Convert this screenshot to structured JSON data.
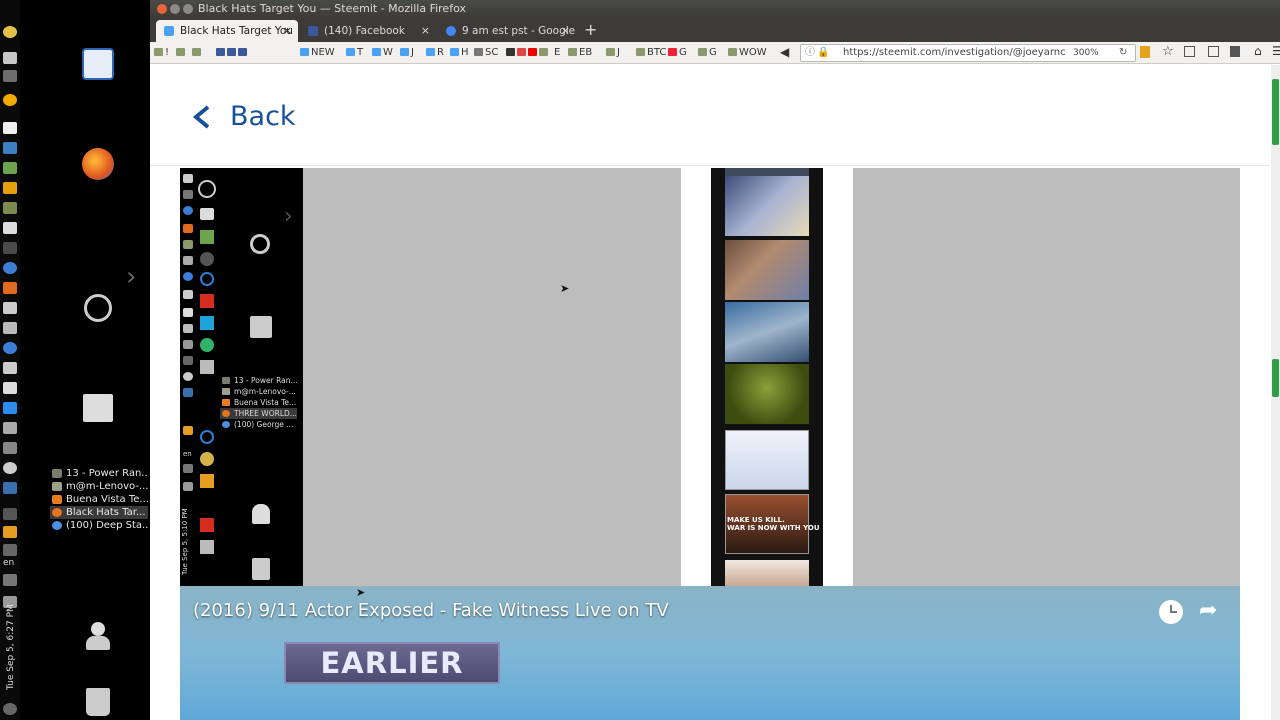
{
  "window": {
    "title": "Black Hats Target You — Steemit - Mozilla Firefox"
  },
  "tabs": [
    {
      "label": "Black Hats Target You",
      "favicon_color": "#4ba2f2"
    },
    {
      "label": "(140) Facebook",
      "favicon_color": "#3b5998"
    },
    {
      "label": "9 am est pst - Google S",
      "favicon_color": "#4285f4"
    }
  ],
  "new_tab_icon": "plus-icon",
  "bookmarks": [
    "!",
    "NEW",
    "T",
    "W",
    "J",
    "R",
    "H",
    "SC",
    "E",
    "EB",
    "J",
    "BTC",
    "G",
    "G",
    "WOW"
  ],
  "address_bar": {
    "url": "https://steemit.com/investigation/@joeyarnc",
    "zoom": "300%"
  },
  "page": {
    "back_label": "Back"
  },
  "desktop": {
    "taskbar": [
      {
        "label": "13 - Power Ran...",
        "color": "#7c7c6c",
        "active": false
      },
      {
        "label": "m@m-Lenovo-...",
        "color": "#9aa08a",
        "active": false
      },
      {
        "label": "Buena Vista Te...",
        "color": "#e87c1e",
        "active": false
      },
      {
        "label": "Black Hats Tar...",
        "color": "#e5731f",
        "active": true
      },
      {
        "label": "(100) Deep Sta...",
        "color": "#4a8fe0",
        "active": false
      }
    ],
    "lang": "en",
    "clock": "Tue Sep 5, 6:27 PM"
  },
  "inner_desktop": {
    "taskbar": [
      {
        "label": "13 - Power Ran...",
        "active": false
      },
      {
        "label": "m@m-Lenovo-...",
        "active": false
      },
      {
        "label": "Buena Vista Te...",
        "active": false
      },
      {
        "label": "THREE WORLD...",
        "active": true
      },
      {
        "label": "(100) George ...",
        "active": false
      }
    ],
    "lang": "en",
    "clock": "Tue Sep 5, 5:10 PM"
  },
  "video": {
    "title": "(2016) 9/11 Actor Exposed - Fake Witness Live on TV",
    "overlay_text": "EARLIER",
    "watch_later_icon": "clock-icon",
    "share_icon": "share-icon"
  },
  "colors": {
    "accent": "#1a5099",
    "titlebar": "#3c3b37"
  }
}
